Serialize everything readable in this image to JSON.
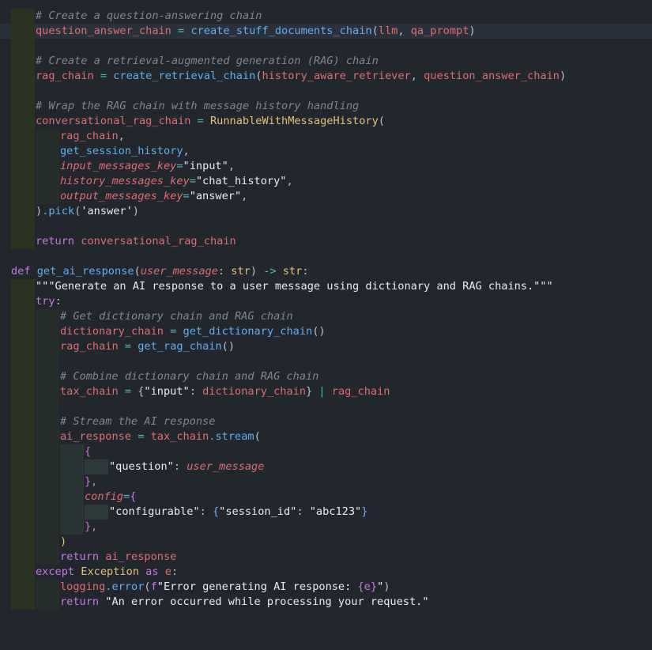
{
  "editor": {
    "colors": {
      "background": "#22272e",
      "comment": "#7f8792",
      "variable": "#e06c75",
      "function": "#61afef",
      "keyword": "#c678dd",
      "type": "#e5c07b",
      "string": "#e9edf2",
      "operator": "#56b6c2"
    },
    "lines": [
      {
        "indent": 1,
        "tokens": [
          [
            "# Create a question-answering chain",
            "cmt"
          ]
        ]
      },
      {
        "indent": 1,
        "highlight": true,
        "tokens": [
          [
            "question_answer_chain",
            "var"
          ],
          [
            " = ",
            "op"
          ],
          [
            "create_stuff_documents_chain",
            "fn"
          ],
          [
            "(",
            "pl"
          ],
          [
            "llm",
            "var"
          ],
          [
            ", ",
            "pl"
          ],
          [
            "qa_prompt",
            "var"
          ],
          [
            ")",
            "pl"
          ]
        ]
      },
      {
        "indent": 1,
        "tokens": []
      },
      {
        "indent": 1,
        "tokens": [
          [
            "# Create a retrieval-augmented generation (RAG) chain",
            "cmt"
          ]
        ]
      },
      {
        "indent": 1,
        "tokens": [
          [
            "rag_chain",
            "var"
          ],
          [
            " = ",
            "op"
          ],
          [
            "create_retrieval_chain",
            "fn"
          ],
          [
            "(",
            "pl"
          ],
          [
            "history_aware_retriever",
            "var"
          ],
          [
            ", ",
            "pl"
          ],
          [
            "question_answer_chain",
            "var"
          ],
          [
            ")",
            "pl"
          ]
        ]
      },
      {
        "indent": 1,
        "tokens": []
      },
      {
        "indent": 1,
        "tokens": [
          [
            "# Wrap the RAG chain with message history handling",
            "cmt"
          ]
        ]
      },
      {
        "indent": 1,
        "tokens": [
          [
            "conversational_rag_chain",
            "var"
          ],
          [
            " = ",
            "op"
          ],
          [
            "RunnableWithMessageHistory",
            "yel"
          ],
          [
            "(",
            "pl"
          ]
        ]
      },
      {
        "indent": 2,
        "tokens": [
          [
            "rag_chain",
            "var"
          ],
          [
            ",",
            "pl"
          ]
        ]
      },
      {
        "indent": 2,
        "tokens": [
          [
            "get_session_history",
            "fn"
          ],
          [
            ",",
            "pl"
          ]
        ]
      },
      {
        "indent": 2,
        "tokens": [
          [
            "input_messages_key",
            "ital"
          ],
          [
            "=",
            "op"
          ],
          [
            "\"input\"",
            "str"
          ],
          [
            ",",
            "pl"
          ]
        ]
      },
      {
        "indent": 2,
        "tokens": [
          [
            "history_messages_key",
            "ital"
          ],
          [
            "=",
            "op"
          ],
          [
            "\"chat_history\"",
            "str"
          ],
          [
            ",",
            "pl"
          ]
        ]
      },
      {
        "indent": 2,
        "tokens": [
          [
            "output_messages_key",
            "ital"
          ],
          [
            "=",
            "op"
          ],
          [
            "\"answer\"",
            "str"
          ],
          [
            ",",
            "pl"
          ]
        ]
      },
      {
        "indent": 1,
        "tokens": [
          [
            ")",
            "pl"
          ],
          [
            ".",
            "op"
          ],
          [
            "pick",
            "fn"
          ],
          [
            "(",
            "pl"
          ],
          [
            "'answer'",
            "str"
          ],
          [
            ")",
            "pl"
          ]
        ]
      },
      {
        "indent": 1,
        "tokens": []
      },
      {
        "indent": 1,
        "tokens": [
          [
            "return",
            "kw"
          ],
          [
            " ",
            "pl"
          ],
          [
            "conversational_rag_chain",
            "var"
          ]
        ]
      },
      {
        "indent": 0,
        "tokens": []
      },
      {
        "indent": 0,
        "tokens": [
          [
            "def",
            "kw"
          ],
          [
            " ",
            "pl"
          ],
          [
            "get_ai_response",
            "fn"
          ],
          [
            "(",
            "pl"
          ],
          [
            "user_message",
            "ital"
          ],
          [
            ": ",
            "pl"
          ],
          [
            "str",
            "yel"
          ],
          [
            ") ",
            "pl"
          ],
          [
            "->",
            "op"
          ],
          [
            " ",
            "pl"
          ],
          [
            "str",
            "yel"
          ],
          [
            ":",
            "pl"
          ]
        ]
      },
      {
        "indent": 1,
        "tokens": [
          [
            "\"\"\"Generate an AI response to a user message using dictionary and RAG chains.\"\"\"",
            "str"
          ]
        ]
      },
      {
        "indent": 1,
        "tokens": [
          [
            "try",
            "kw"
          ],
          [
            ":",
            "pl"
          ]
        ]
      },
      {
        "indent": 2,
        "tokens": [
          [
            "# Get dictionary chain and RAG chain",
            "cmt"
          ]
        ]
      },
      {
        "indent": 2,
        "tokens": [
          [
            "dictionary_chain",
            "var"
          ],
          [
            " = ",
            "op"
          ],
          [
            "get_dictionary_chain",
            "fn"
          ],
          [
            "()",
            "pl"
          ]
        ]
      },
      {
        "indent": 2,
        "tokens": [
          [
            "rag_chain",
            "var"
          ],
          [
            " = ",
            "op"
          ],
          [
            "get_rag_chain",
            "fn"
          ],
          [
            "()",
            "pl"
          ]
        ]
      },
      {
        "indent": 2,
        "tokens": []
      },
      {
        "indent": 2,
        "tokens": [
          [
            "# Combine dictionary chain and RAG chain",
            "cmt"
          ]
        ]
      },
      {
        "indent": 2,
        "tokens": [
          [
            "tax_chain",
            "var"
          ],
          [
            " = ",
            "op"
          ],
          [
            "{",
            "pl"
          ],
          [
            "\"input\"",
            "str"
          ],
          [
            ": ",
            "pl"
          ],
          [
            "dictionary_chain",
            "var"
          ],
          [
            "} ",
            "pl"
          ],
          [
            "|",
            "op"
          ],
          [
            " ",
            "pl"
          ],
          [
            "rag_chain",
            "var"
          ]
        ]
      },
      {
        "indent": 2,
        "tokens": []
      },
      {
        "indent": 2,
        "tokens": [
          [
            "# Stream the AI response",
            "cmt"
          ]
        ]
      },
      {
        "indent": 2,
        "tokens": [
          [
            "ai_response",
            "var"
          ],
          [
            " = ",
            "op"
          ],
          [
            "tax_chain",
            "var"
          ],
          [
            ".",
            "op"
          ],
          [
            "stream",
            "fn"
          ],
          [
            "(",
            "pl"
          ]
        ]
      },
      {
        "indent": 3,
        "tokens": [
          [
            "{",
            "kw"
          ]
        ]
      },
      {
        "indent": 4,
        "tokens": [
          [
            "\"question\"",
            "str"
          ],
          [
            ": ",
            "pl"
          ],
          [
            "user_message",
            "ital"
          ]
        ]
      },
      {
        "indent": 3,
        "tokens": [
          [
            "},",
            "kw"
          ]
        ]
      },
      {
        "indent": 3,
        "tokens": [
          [
            "config",
            "ital"
          ],
          [
            "=",
            "op"
          ],
          [
            "{",
            "kw"
          ]
        ]
      },
      {
        "indent": 4,
        "tokens": [
          [
            "\"configurable\"",
            "str"
          ],
          [
            ": ",
            "pl"
          ],
          [
            "{",
            "bl2"
          ],
          [
            "\"session_id\"",
            "str"
          ],
          [
            ": ",
            "pl"
          ],
          [
            "\"abc123\"",
            "str"
          ],
          [
            "}",
            "bl2"
          ]
        ]
      },
      {
        "indent": 3,
        "tokens": [
          [
            "},",
            "kw"
          ]
        ]
      },
      {
        "indent": 2,
        "tokens": [
          [
            ")",
            "yel"
          ]
        ]
      },
      {
        "indent": 2,
        "tokens": [
          [
            "return",
            "kw"
          ],
          [
            " ",
            "pl"
          ],
          [
            "ai_response",
            "var"
          ]
        ]
      },
      {
        "indent": 1,
        "tokens": [
          [
            "except",
            "kw"
          ],
          [
            " ",
            "pl"
          ],
          [
            "Exception",
            "yel"
          ],
          [
            " ",
            "pl"
          ],
          [
            "as",
            "kw"
          ],
          [
            " ",
            "pl"
          ],
          [
            "e",
            "var"
          ],
          [
            ":",
            "pl"
          ]
        ]
      },
      {
        "indent": 2,
        "tokens": [
          [
            "logging",
            "var"
          ],
          [
            ".",
            "op"
          ],
          [
            "error",
            "fn"
          ],
          [
            "(",
            "pl"
          ],
          [
            "f",
            "kw"
          ],
          [
            "\"Error generating AI response: ",
            "str"
          ],
          [
            "{e}",
            "kw"
          ],
          [
            "\"",
            "str"
          ],
          [
            ")",
            "pl"
          ]
        ]
      },
      {
        "indent": 2,
        "tokens": [
          [
            "return",
            "kw"
          ],
          [
            " ",
            "pl"
          ],
          [
            "\"An error occurred while processing your request.\"",
            "str"
          ]
        ]
      }
    ]
  }
}
